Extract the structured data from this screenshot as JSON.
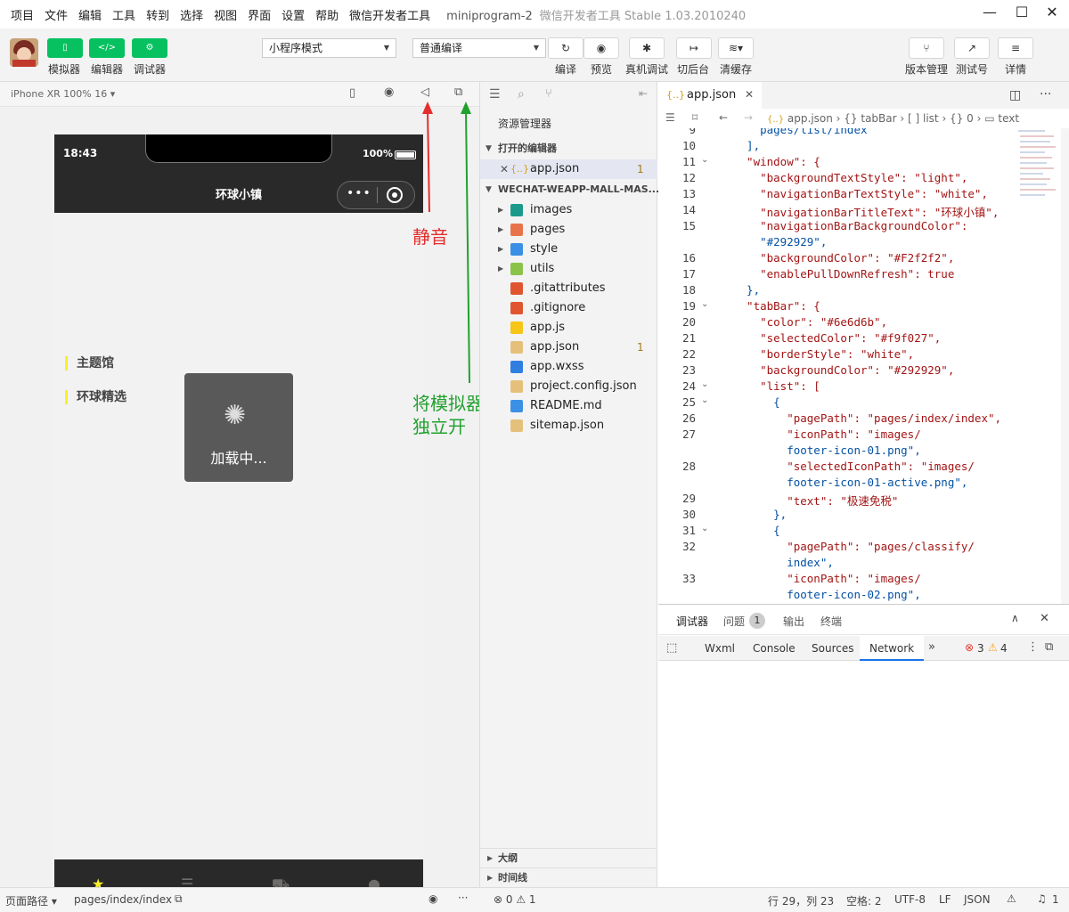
{
  "menu": {
    "items": [
      "项目",
      "文件",
      "编辑",
      "工具",
      "转到",
      "选择",
      "视图",
      "界面",
      "设置",
      "帮助",
      "微信开发者工具"
    ],
    "project": "miniprogram-2",
    "app_title": "微信开发者工具 Stable 1.03.2010240"
  },
  "toolbar": {
    "simulator": "模拟器",
    "editor": "编辑器",
    "debugger": "调试器",
    "mode_select": "小程序模式",
    "compile_select": "普通编译",
    "compile": "编译",
    "preview": "预览",
    "remote_debug": "真机调试",
    "background": "切后台",
    "clear_cache": "清缓存",
    "version": "版本管理",
    "test": "测试号",
    "details": "详情"
  },
  "simulator": {
    "device": "iPhone XR 100% 16",
    "time": "18:43",
    "battery": "100%",
    "nav_title": "环球小镇",
    "side_1": "主题馆",
    "side_2": "环球精选",
    "loading": "加载中..."
  },
  "annotations": {
    "mute": "静音",
    "detach_line1": "将模拟器",
    "detach_line2": "独立开"
  },
  "explorer": {
    "title": "资源管理器",
    "open_editors": "打开的编辑器",
    "open_file": "app.json",
    "open_badge": "1",
    "project": "WECHAT-WEAPP-MALL-MAS...",
    "files": [
      {
        "name": "images",
        "color": "#1b9a8c"
      },
      {
        "name": "pages",
        "color": "#e8734a"
      },
      {
        "name": "style",
        "color": "#3b8fe4"
      },
      {
        "name": "utils",
        "color": "#8bc34a"
      },
      {
        "name": ".gitattributes",
        "color": "#e0552f"
      },
      {
        "name": ".gitignore",
        "color": "#e0552f"
      },
      {
        "name": "app.js",
        "color": "#f5c518"
      },
      {
        "name": "app.json",
        "color": "#e5c07b"
      },
      {
        "name": "app.wxss",
        "color": "#2f7ee0"
      },
      {
        "name": "project.config.json",
        "color": "#e5c07b"
      },
      {
        "name": "README.md",
        "color": "#3b8fe4"
      },
      {
        "name": "sitemap.json",
        "color": "#e5c07b"
      }
    ],
    "appjson_badge": "1",
    "outline": "大纲",
    "timeline": "时间线"
  },
  "editor": {
    "tab": "app.json",
    "breadcrumb": [
      "app.json",
      "tabBar",
      "list",
      "0",
      "text"
    ],
    "lines": [
      {
        "n": "9",
        "t": "    pages/list/index"
      },
      {
        "n": "10",
        "t": "  ],"
      },
      {
        "n": "11",
        "t": "  \"window\": {"
      },
      {
        "n": "12",
        "t": "    \"backgroundTextStyle\": \"light\","
      },
      {
        "n": "13",
        "t": "    \"navigationBarTextStyle\": \"white\","
      },
      {
        "n": "14",
        "t": "    \"navigationBarTitleText\": \"环球小镇\","
      },
      {
        "n": "15",
        "t": "    \"navigationBarBackgroundColor\":"
      },
      {
        "n": "",
        "t": "    \"#292929\","
      },
      {
        "n": "16",
        "t": "    \"backgroundColor\": \"#F2f2f2\","
      },
      {
        "n": "17",
        "t": "    \"enablePullDownRefresh\": true"
      },
      {
        "n": "18",
        "t": "  },"
      },
      {
        "n": "19",
        "t": "  \"tabBar\": {"
      },
      {
        "n": "20",
        "t": "    \"color\": \"#6e6d6b\","
      },
      {
        "n": "21",
        "t": "    \"selectedColor\": \"#f9f027\","
      },
      {
        "n": "22",
        "t": "    \"borderStyle\": \"white\","
      },
      {
        "n": "23",
        "t": "    \"backgroundColor\": \"#292929\","
      },
      {
        "n": "24",
        "t": "    \"list\": ["
      },
      {
        "n": "25",
        "t": "      {"
      },
      {
        "n": "26",
        "t": "        \"pagePath\": \"pages/index/index\","
      },
      {
        "n": "27",
        "t": "        \"iconPath\": \"images/"
      },
      {
        "n": "",
        "t": "        footer-icon-01.png\","
      },
      {
        "n": "28",
        "t": "        \"selectedIconPath\": \"images/"
      },
      {
        "n": "",
        "t": "        footer-icon-01-active.png\","
      },
      {
        "n": "29",
        "t": "        \"text\": \"极速免税\""
      },
      {
        "n": "30",
        "t": "      },"
      },
      {
        "n": "31",
        "t": "      {"
      },
      {
        "n": "32",
        "t": "        \"pagePath\": \"pages/classify/"
      },
      {
        "n": "",
        "t": "        index\","
      },
      {
        "n": "33",
        "t": "        \"iconPath\": \"images/"
      },
      {
        "n": "",
        "t": "        footer-icon-02.png\","
      }
    ]
  },
  "devtools": {
    "tabs": [
      "调试器",
      "问题",
      "输出",
      "终端"
    ],
    "issues_count": "1",
    "panels": [
      "Wxml",
      "Console",
      "Sources",
      "Network"
    ],
    "errors": "3",
    "warnings": "4"
  },
  "statusbar": {
    "page_path_label": "页面路径",
    "page_path": "pages/index/index",
    "errors": "0",
    "warnings": "1",
    "position": "行 29，列 23",
    "spaces": "空格: 2",
    "encoding": "UTF-8",
    "eol": "LF",
    "language": "JSON",
    "notifications": "1"
  },
  "colors": {
    "accent_green": "#07c160",
    "nav_dark": "#292929",
    "selected": "#f9f027"
  }
}
